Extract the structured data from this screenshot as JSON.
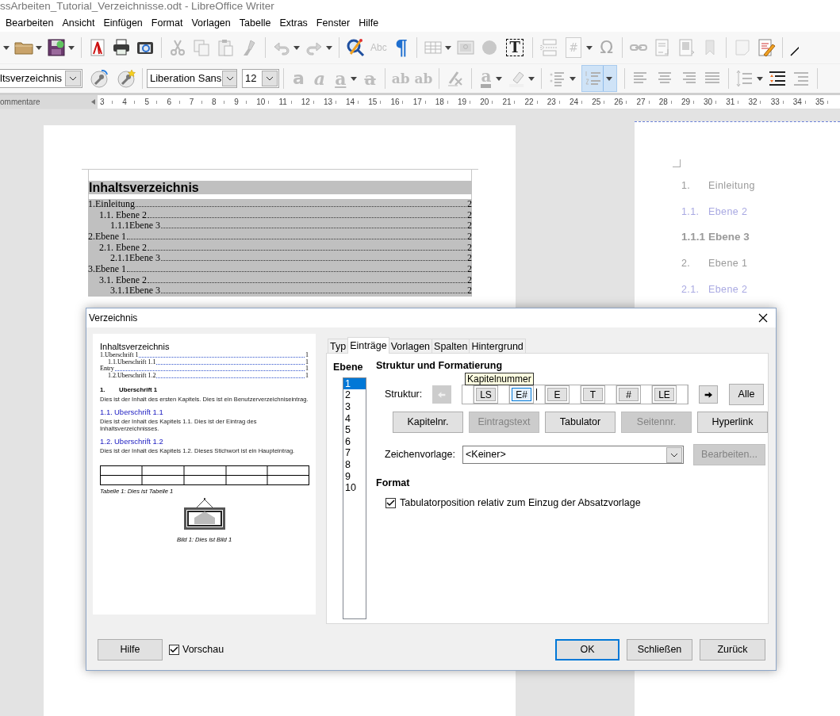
{
  "window": {
    "title": "ssArbeiten_Tutorial_Verzeichnisse.odt - LibreOffice Writer"
  },
  "menu": [
    "Bearbeiten",
    "Ansicht",
    "Einfügen",
    "Format",
    "Vorlagen",
    "Tabelle",
    "Extras",
    "Fenster",
    "Hilfe"
  ],
  "standard_toolbar": {
    "glyphs": [
      "Abc",
      "¶",
      "T",
      "#",
      "Ω"
    ]
  },
  "format_toolbar": {
    "paragraph_style": "ltsverzeichnis",
    "font_name": "Liberation Sans",
    "font_size": "12",
    "glyphs": [
      "a",
      "a",
      "a",
      "a",
      "ab",
      "ab",
      "a"
    ],
    "numbering_on": true
  },
  "ruler": {
    "panel_label": "ommentare",
    "numbers": [
      "3",
      "4",
      "5",
      "6",
      "7",
      "8",
      "9",
      "10",
      "11",
      "12",
      "13",
      "14",
      "15",
      "16",
      "17",
      "18",
      "19",
      "20",
      "21",
      "22",
      "23",
      "24",
      "25",
      "26",
      "27",
      "28",
      "29",
      "30",
      "31",
      "32",
      "33",
      "34",
      "35"
    ]
  },
  "document": {
    "toc_title": "Inhaltsverzeichnis",
    "toc_entries": [
      {
        "text": "1.Einleitung",
        "page": "2",
        "children": [
          {
            "text": "1.1. Ebene 2",
            "page": "2",
            "children": [
              {
                "text": "1.1.1Ebene 3",
                "page": "2"
              }
            ]
          }
        ]
      },
      {
        "text": "2.Ebene 1",
        "page": "2",
        "children": [
          {
            "text": "2.1. Ebene 2",
            "page": "2",
            "children": [
              {
                "text": "2.1.1Ebene 3",
                "page": "2"
              }
            ]
          }
        ]
      },
      {
        "text": "3.Ebene 1",
        "page": "2",
        "children": [
          {
            "text": "3.1. Ebene 2",
            "page": "2",
            "children": [
              {
                "text": "3.1.1Ebene 3",
                "page": "2"
              }
            ]
          }
        ]
      }
    ]
  },
  "next_page": {
    "entries": [
      {
        "number": "1.",
        "title": "Einleitung",
        "children": [
          {
            "number": "1.1.",
            "title": "Ebene 2",
            "children": [
              {
                "number": "1.1.1",
                "title": "Ebene 3"
              }
            ]
          }
        ]
      },
      {
        "number": "2.",
        "title": "Ebene 1",
        "children": [
          {
            "number": "2.1.",
            "title": "Ebene 2"
          }
        ]
      }
    ]
  },
  "dialog": {
    "title": "Verzeichnis",
    "preview": {
      "title": "Inhaltsverzeichnis",
      "toc": [
        {
          "text": "1.Uberschrift 1",
          "page": "1",
          "children": [
            {
              "text": "1.1.Uberschrift 1.1",
              "page": "1"
            }
          ]
        },
        {
          "text": "Entry",
          "page": "1",
          "children": [
            {
              "text": "1.2.Uberschrift 1.2",
              "page": "1"
            }
          ]
        }
      ],
      "sections": [
        {
          "kind": "h1",
          "number": "1.",
          "heading": "Uberschrift 1",
          "body": "Dies ist der Inhalt des ersten Kapitels. Dies ist ein Benutzerverzeichniseintrag."
        },
        {
          "kind": "h2",
          "number": "1.1.",
          "heading": "Uberschrift 1.1",
          "body": "Dies ist der Inhalt des Kapitels 1.1. Dies ist der Eintrag des Inhaltsverzeichnisses."
        },
        {
          "kind": "h2",
          "number": "1.2.",
          "heading": "Uberschrift 1.2",
          "body": "Dies ist der Inhalt des Kapitels 1.2. Dieses Stichwort ist ein Haupteintrag."
        }
      ],
      "table_caption": "Tabelle 1: Dies ist Tabelle 1",
      "image_caption": "Bild 1: Dies ist Bild 1"
    },
    "tabs": [
      {
        "label": "Typ",
        "selected": false
      },
      {
        "label": "Einträge",
        "selected": true
      },
      {
        "label": "Vorlagen",
        "selected": false
      },
      {
        "label": "Spalten",
        "selected": false
      },
      {
        "label": "Hintergrund",
        "selected": false
      }
    ],
    "level_label": "Ebene",
    "levels": [
      {
        "label": "1",
        "selected": true
      },
      {
        "label": "2",
        "selected": false
      },
      {
        "label": "3",
        "selected": false
      },
      {
        "label": "4",
        "selected": false
      },
      {
        "label": "5",
        "selected": false
      },
      {
        "label": "6",
        "selected": false
      },
      {
        "label": "7",
        "selected": false
      },
      {
        "label": "8",
        "selected": false
      },
      {
        "label": "9",
        "selected": false
      },
      {
        "label": "10",
        "selected": false
      }
    ],
    "structure_heading": "Struktur und Formatierung",
    "tooltip": "Kapitelnummer",
    "structure_label": "Struktur:",
    "prev_disabled": true,
    "next_disabled": false,
    "structure": [
      {
        "kind": "gap",
        "cursor": false
      },
      {
        "kind": "token",
        "label": "LS",
        "selected": false
      },
      {
        "kind": "gap",
        "cursor": false
      },
      {
        "kind": "token",
        "label": "E#",
        "selected": true
      },
      {
        "kind": "gap",
        "cursor": true
      },
      {
        "kind": "token",
        "label": "E",
        "selected": false
      },
      {
        "kind": "gap",
        "cursor": false
      },
      {
        "kind": "token",
        "label": "T",
        "selected": false
      },
      {
        "kind": "gap",
        "cursor": false
      },
      {
        "kind": "token",
        "label": "#",
        "selected": false
      },
      {
        "kind": "gap",
        "cursor": false
      },
      {
        "kind": "token",
        "label": "LE",
        "selected": false
      },
      {
        "kind": "gap",
        "cursor": false
      }
    ],
    "all_button": "Alle",
    "insert_buttons": [
      {
        "label": "Kapitelnr.",
        "disabled": false
      },
      {
        "label": "Eintragstext",
        "disabled": true
      },
      {
        "label": "Tabulator",
        "disabled": false
      },
      {
        "label": "Seitennr.",
        "disabled": true
      },
      {
        "label": "Hyperlink",
        "disabled": false
      }
    ],
    "char_style_label": "Zeichenvorlage:",
    "char_style": "<Keiner>",
    "edit_button": {
      "label": "Bearbeiten...",
      "disabled": true
    },
    "format_heading": "Format",
    "tab_relative": {
      "label": "Tabulatorposition relativ zum Einzug der Absatzvorlage",
      "checked": true
    },
    "help_button": "Hilfe",
    "preview_toggle": {
      "label": "Vorschau",
      "checked": true
    },
    "buttons": [
      {
        "label": "OK",
        "default": true
      },
      {
        "label": "Schließen",
        "default": false
      },
      {
        "label": "Zurück",
        "default": false
      }
    ]
  }
}
